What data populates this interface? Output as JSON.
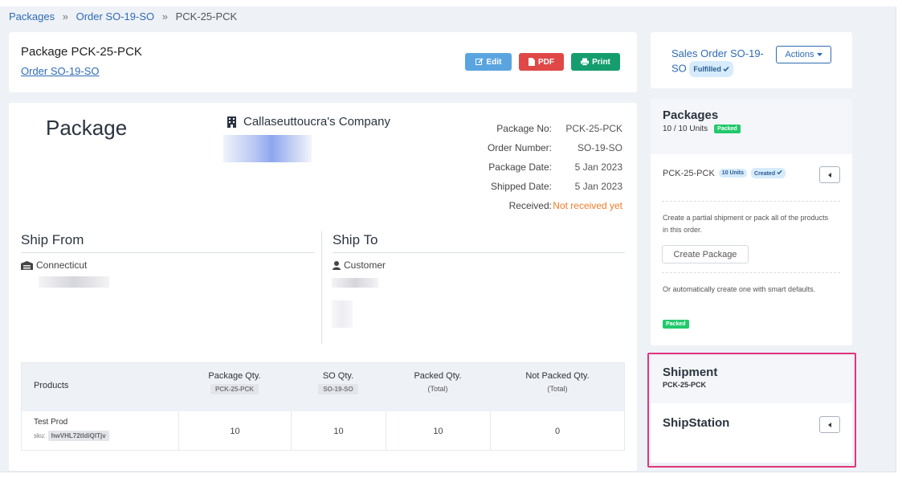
{
  "breadcrumb": {
    "items": [
      "Packages",
      "Order SO-19-SO",
      "PCK-25-PCK"
    ],
    "sep": "»"
  },
  "header": {
    "title": "Package PCK-25-PCK",
    "order_link": "Order SO-19-SO",
    "buttons": {
      "edit": "Edit",
      "pdf": "PDF",
      "print": "Print"
    }
  },
  "package": {
    "heading": "Package",
    "company": "Callaseuttoucra's Company",
    "meta": [
      {
        "key": "Package No:",
        "value": "PCK-25-PCK"
      },
      {
        "key": "Order Number:",
        "value": "SO-19-SO"
      },
      {
        "key": "Package Date:",
        "value": "5 Jan 2023"
      },
      {
        "key": "Shipped Date:",
        "value": "5 Jan 2023"
      },
      {
        "key": "Received:",
        "value": "Not received yet"
      }
    ]
  },
  "ship_from": {
    "title": "Ship From",
    "name": "Connecticut"
  },
  "ship_to": {
    "title": "Ship To",
    "name": "Customer"
  },
  "table": {
    "headers": {
      "products": "Products",
      "package_qty": "Package Qty.",
      "package_qty_tag": "PCK-25-PCK",
      "so_qty": "SO Qty.",
      "so_qty_tag": "SO-19-SO",
      "packed_qty": "Packed Qty.",
      "packed_total": "(Total)",
      "not_packed_qty": "Not Packed Qty.",
      "not_packed_total": "(Total)"
    },
    "rows": [
      {
        "product": "Test Prod",
        "sku_label": "sku:",
        "sku": "hwVHL72tldiQlTjv",
        "package_qty": "10",
        "so_qty": "10",
        "packed_qty": "10",
        "not_packed_qty": "0"
      }
    ]
  },
  "sales_order": {
    "link": "Sales Order SO-19-SO",
    "status": "Fulfilled",
    "actions": "Actions"
  },
  "packages_panel": {
    "title": "Packages",
    "units": "10 / 10 Units",
    "status": "Packed",
    "item": {
      "name": "PCK-25-PCK",
      "units": "10 Units",
      "status": "Created"
    },
    "note1": "Create a partial shipment or pack all of the products in this order.",
    "create_btn": "Create Package",
    "note2": "Or automatically create one with smart defaults.",
    "status2": "Packed"
  },
  "shipment_panel": {
    "title": "Shipment",
    "sub": "PCK-25-PCK",
    "provider": "ShipStation"
  },
  "colors": {
    "link": "#2f6bb4",
    "edit": "#5aa5e0",
    "pdf": "#e04848",
    "print": "#159d6e",
    "packed": "#22c96b",
    "warn": "#ee7d2a",
    "highlight": "#e0357f"
  },
  "icons": [
    "edit-icon",
    "pdf-icon",
    "print-icon",
    "building-icon",
    "warehouse-icon",
    "user-icon",
    "caret-down-icon",
    "check-icon",
    "caret-left-icon"
  ]
}
